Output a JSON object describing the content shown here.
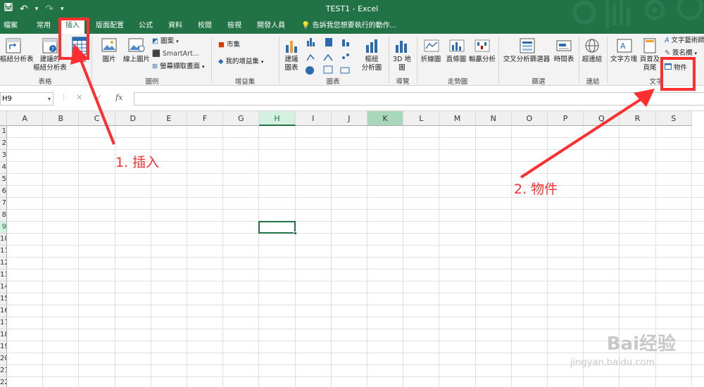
{
  "window": {
    "title": "TEST1 - Excel"
  },
  "quick_access": {
    "save_icon": "save-icon",
    "undo_icon": "undo-icon",
    "redo_icon": "redo-icon",
    "customize_icon": "customize-icon",
    "undo_glyph": "↶",
    "redo_glyph": "↷",
    "dropdown_glyph": "▾"
  },
  "tabs": {
    "file": "檔案",
    "home": "常用",
    "insert": "插入",
    "layout": "版面配置",
    "formulas": "公式",
    "data": "資料",
    "review": "校閱",
    "view": "檢視",
    "developer": "開發人員"
  },
  "tell_me": "告訴我您想要執行的動作...",
  "ribbon": {
    "pivottable": "樞紐分析表",
    "recommended_pivot_1": "建議的",
    "recommended_pivot_2": "樞紐分析表",
    "table": "表格",
    "group_tables": "表格",
    "pictures": "圖片",
    "online_pictures": "線上圖片",
    "shapes": "圖案",
    "smartart": "SmartArt...",
    "screenshot": "螢幕擷取畫面",
    "group_illustrations": "圖例",
    "store": "市集",
    "my_addins": "我的增益集",
    "group_addins": "增益集",
    "recommended_charts_1": "建議",
    "recommended_charts_2": "圖表",
    "pivotchart_1": "樞紐",
    "pivotchart_2": "分析圖",
    "group_charts": "圖表",
    "map_1": "3D 地",
    "map_2": "圖",
    "group_tours": "導覽",
    "line": "折線圖",
    "column": "直條圖",
    "winloss": "輸贏分析",
    "group_sparklines": "走勢圖",
    "slicer": "交叉分析篩選器",
    "timeline": "時間表",
    "group_filters": "篩選",
    "hyperlink": "超連結",
    "group_links": "連結",
    "textbox": "文字方塊",
    "header_1": "頁首及",
    "header_2": "頁尾",
    "wordart": "文字藝術師",
    "signature": "簽名欄",
    "object": "物件",
    "group_text": "文字"
  },
  "formula_bar": {
    "name_box": "H9",
    "cancel": "✕",
    "enter": "✓",
    "fx": "fx"
  },
  "sheet": {
    "columns": [
      "A",
      "B",
      "C",
      "D",
      "E",
      "F",
      "G",
      "H",
      "I",
      "J",
      "K",
      "L",
      "M",
      "N",
      "O",
      "P",
      "Q",
      "R",
      "S"
    ],
    "rows": [
      "1",
      "2",
      "3",
      "4",
      "5",
      "6",
      "7",
      "8",
      "9",
      "10",
      "11",
      "12",
      "13",
      "14",
      "15",
      "16",
      "17",
      "18",
      "19",
      "20",
      "21",
      "22"
    ],
    "selected_cell": "H9"
  },
  "annotations": {
    "step1": "1. 插入",
    "step2": "2. 物件",
    "color": "#ff2f2f"
  },
  "watermark": {
    "brand": "Bai经验",
    "url": "jingyan.baidu.com"
  },
  "colors": {
    "accent": "#217346",
    "annotation": "#ff2f2f"
  }
}
